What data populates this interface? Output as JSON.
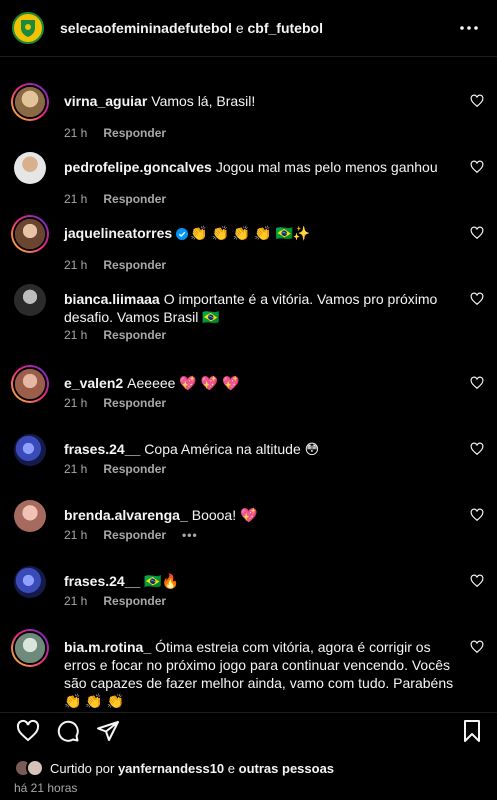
{
  "header": {
    "account1": "selecaofemininadefutebol",
    "conjunction": "e",
    "account2": "cbf_futebol"
  },
  "comments": [
    {
      "user": "virna_aguiar",
      "text": "Vamos lá, Brasil!",
      "time": "21 h",
      "reply": "Responder",
      "avatar_color": "#c9a77e"
    },
    {
      "user": "pedrofelipe.goncalves",
      "text": "Jogou mal mas pelo menos ganhou",
      "time": "21 h",
      "reply": "Responder",
      "avatar_color": "#d8d8d8"
    },
    {
      "user": "jaquelineatorres",
      "text": "👏 👏 👏 👏 🇧🇷✨",
      "time": "21 h",
      "reply": "Responder",
      "avatar_color": "#b07a5a"
    },
    {
      "user": "bianca.liimaaa",
      "text": "O importante é a vitória. Vamos pro próximo desafio. Vamos Brasil 🇧🇷",
      "time": "21 h",
      "reply": "Responder",
      "avatar_color": "#6f6f6f"
    },
    {
      "user": "e_valen2",
      "text": "Aeeeee 💖 💖 💖",
      "time": "21 h",
      "reply": "Responder",
      "avatar_color": "#c98f7a"
    },
    {
      "user": "frases.24__",
      "text": "Copa América na altitude 😳",
      "time": "21 h",
      "reply": "Responder",
      "avatar_color": "#2a3a8a"
    },
    {
      "user": "brenda.alvarenga_",
      "text": "Boooa! 💖",
      "time": "21 h",
      "reply": "Responder",
      "more": "•••",
      "avatar_color": "#c8968a"
    },
    {
      "user": "frases.24__",
      "text": "🇧🇷🔥",
      "time": "21 h",
      "reply": "Responder",
      "avatar_color": "#2a3a8a"
    },
    {
      "user": "bia.m.rotina_",
      "text": "Ótima estreia com vitória, agora é corrigir os erros e focar no próximo jogo para continuar vencendo. Vocês são capazes de fazer melhor ainda, vamo com tudo. Parabéns 👏 👏 👏",
      "time": "",
      "reply": "",
      "avatar_color": "#9fb3a8"
    }
  ],
  "likes": {
    "prefix": "Curtido por",
    "user": "yanfernandess10",
    "middle": "e",
    "others": "outras pessoas"
  },
  "post_time": "há 21 horas",
  "icons": {
    "like": "heart-icon",
    "comment": "comment-icon",
    "share": "share-icon",
    "save": "bookmark-icon",
    "more": "more-options-icon"
  },
  "colors": {
    "background": "#000000",
    "text": "#f5f5f5",
    "muted": "#a8a8a8",
    "verified": "#0095f6"
  }
}
